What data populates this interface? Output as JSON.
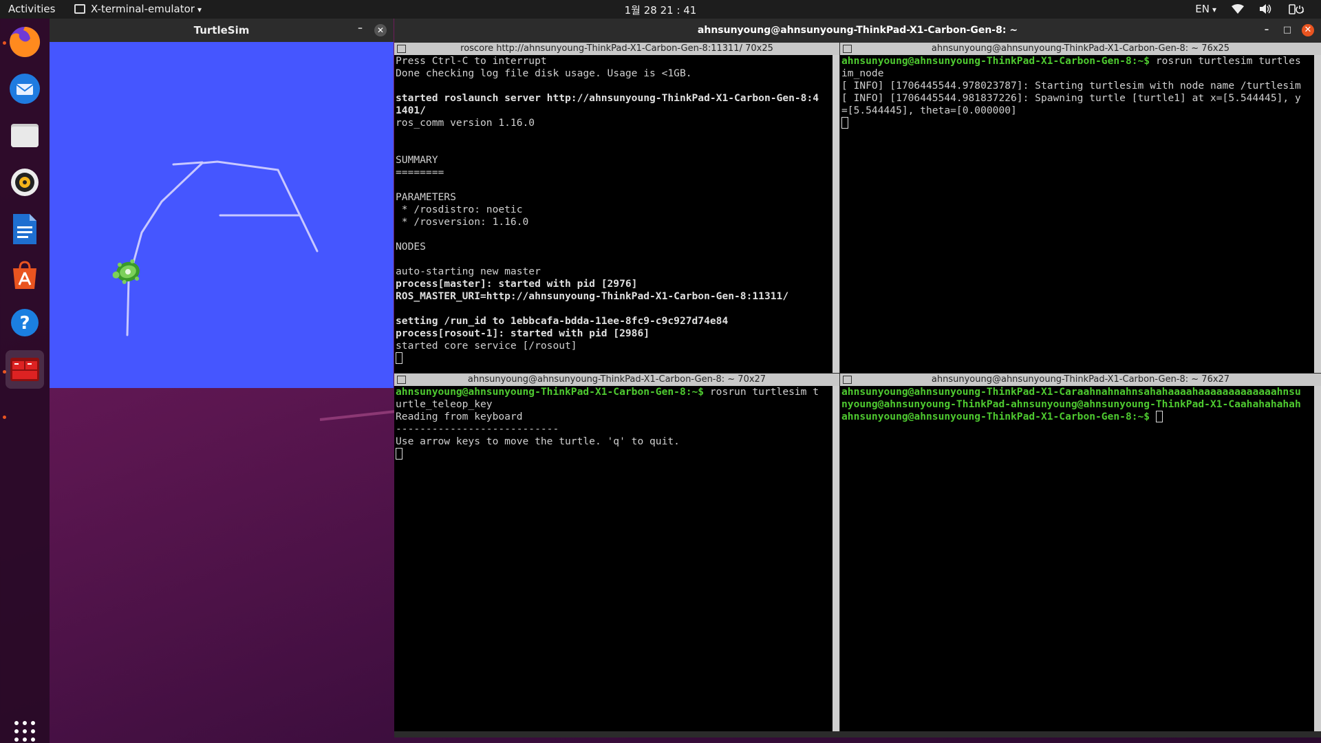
{
  "topbar": {
    "activities": "Activities",
    "app_menu": "X-terminal-emulator",
    "clock": "1월 28  21 : 41",
    "lang": "EN"
  },
  "dock": {
    "items": [
      "firefox-icon",
      "thunderbird-icon",
      "files-icon",
      "rhythmbox-icon",
      "libreoffice-writer-icon",
      "software-center-icon",
      "help-icon",
      "terminal-icon"
    ],
    "grid_label": "show-applications-icon"
  },
  "turtlesim": {
    "title": "TurtleSim",
    "min": "–",
    "close": "✕",
    "bg_color": "#4556ff",
    "path_color": "#c8c8ff"
  },
  "terminal": {
    "title": "ahnsunyoung@ahnsunyoung-ThinkPad-X1-Carbon-Gen-8: ~",
    "panes": {
      "tl": {
        "header": "roscore http://ahnsunyoung-ThinkPad-X1-Carbon-Gen-8:11311/ 70x25",
        "lines": [
          {
            "t": "Press Ctrl-C to interrupt",
            "s": ""
          },
          {
            "t": "Done checking log file disk usage. Usage is <1GB.",
            "s": ""
          },
          {
            "t": "",
            "s": ""
          },
          {
            "t": "started roslaunch server http://ahnsunyoung-ThinkPad-X1-Carbon-Gen-8:4",
            "s": "b"
          },
          {
            "t": "1401/",
            "s": "b"
          },
          {
            "t": "ros_comm version 1.16.0",
            "s": ""
          },
          {
            "t": "",
            "s": ""
          },
          {
            "t": "",
            "s": ""
          },
          {
            "t": "SUMMARY",
            "s": ""
          },
          {
            "t": "========",
            "s": ""
          },
          {
            "t": "",
            "s": ""
          },
          {
            "t": "PARAMETERS",
            "s": ""
          },
          {
            "t": " * /rosdistro: noetic",
            "s": ""
          },
          {
            "t": " * /rosversion: 1.16.0",
            "s": ""
          },
          {
            "t": "",
            "s": ""
          },
          {
            "t": "NODES",
            "s": ""
          },
          {
            "t": "",
            "s": ""
          },
          {
            "t": "auto-starting new master",
            "s": ""
          },
          {
            "t": "process[master]: started with pid [2976]",
            "s": "b"
          },
          {
            "t": "ROS_MASTER_URI=http://ahnsunyoung-ThinkPad-X1-Carbon-Gen-8:11311/",
            "s": "b"
          },
          {
            "t": "",
            "s": ""
          },
          {
            "t": "setting /run_id to 1ebbcafa-bdda-11ee-8fc9-c9c927d74e84",
            "s": "b"
          },
          {
            "t": "process[rosout-1]: started with pid [2986]",
            "s": "b"
          },
          {
            "t": "started core service [/rosout]",
            "s": ""
          }
        ]
      },
      "tr": {
        "header": "ahnsunyoung@ahnsunyoung-ThinkPad-X1-Carbon-Gen-8: ~ 76x25",
        "prompt": "ahnsunyoung@ahnsunyoung-ThinkPad-X1-Carbon-Gen-8:~$ ",
        "cmd": "rosrun turtlesim turtles",
        "lines": [
          "im_node",
          "[ INFO] [1706445544.978023787]: Starting turtlesim with node name /turtlesim",
          "[ INFO] [1706445544.981837226]: Spawning turtle [turtle1] at x=[5.544445], y",
          "=[5.544445], theta=[0.000000]"
        ]
      },
      "bl": {
        "header": "ahnsunyoung@ahnsunyoung-ThinkPad-X1-Carbon-Gen-8: ~ 70x27",
        "prompt": "ahnsunyoung@ahnsunyoung-ThinkPad-X1-Carbon-Gen-8:~$ ",
        "cmd": "rosrun turtlesim t",
        "lines": [
          "urtle_teleop_key",
          "Reading from keyboard",
          "---------------------------",
          "Use arrow keys to move the turtle. 'q' to quit."
        ]
      },
      "br": {
        "header": "ahnsunyoung@ahnsunyoung-ThinkPad-X1-Carbon-Gen-8: ~ 76x27",
        "line1": "ahnsunyoung@ahnsunyoung-ThinkPad-X1-Caraahnahnahnsahahaaaahaaaaaaaaaaaaahnsu",
        "line2": "nyoung@ahnsunyoung-ThinkPad-ahnsunyoung@ahnsunyoung-ThinkPad-X1-Caahahahahah",
        "prompt": "ahnsunyoung@ahnsunyoung-ThinkPad-X1-Carbon-Gen-8:~$ "
      }
    }
  }
}
